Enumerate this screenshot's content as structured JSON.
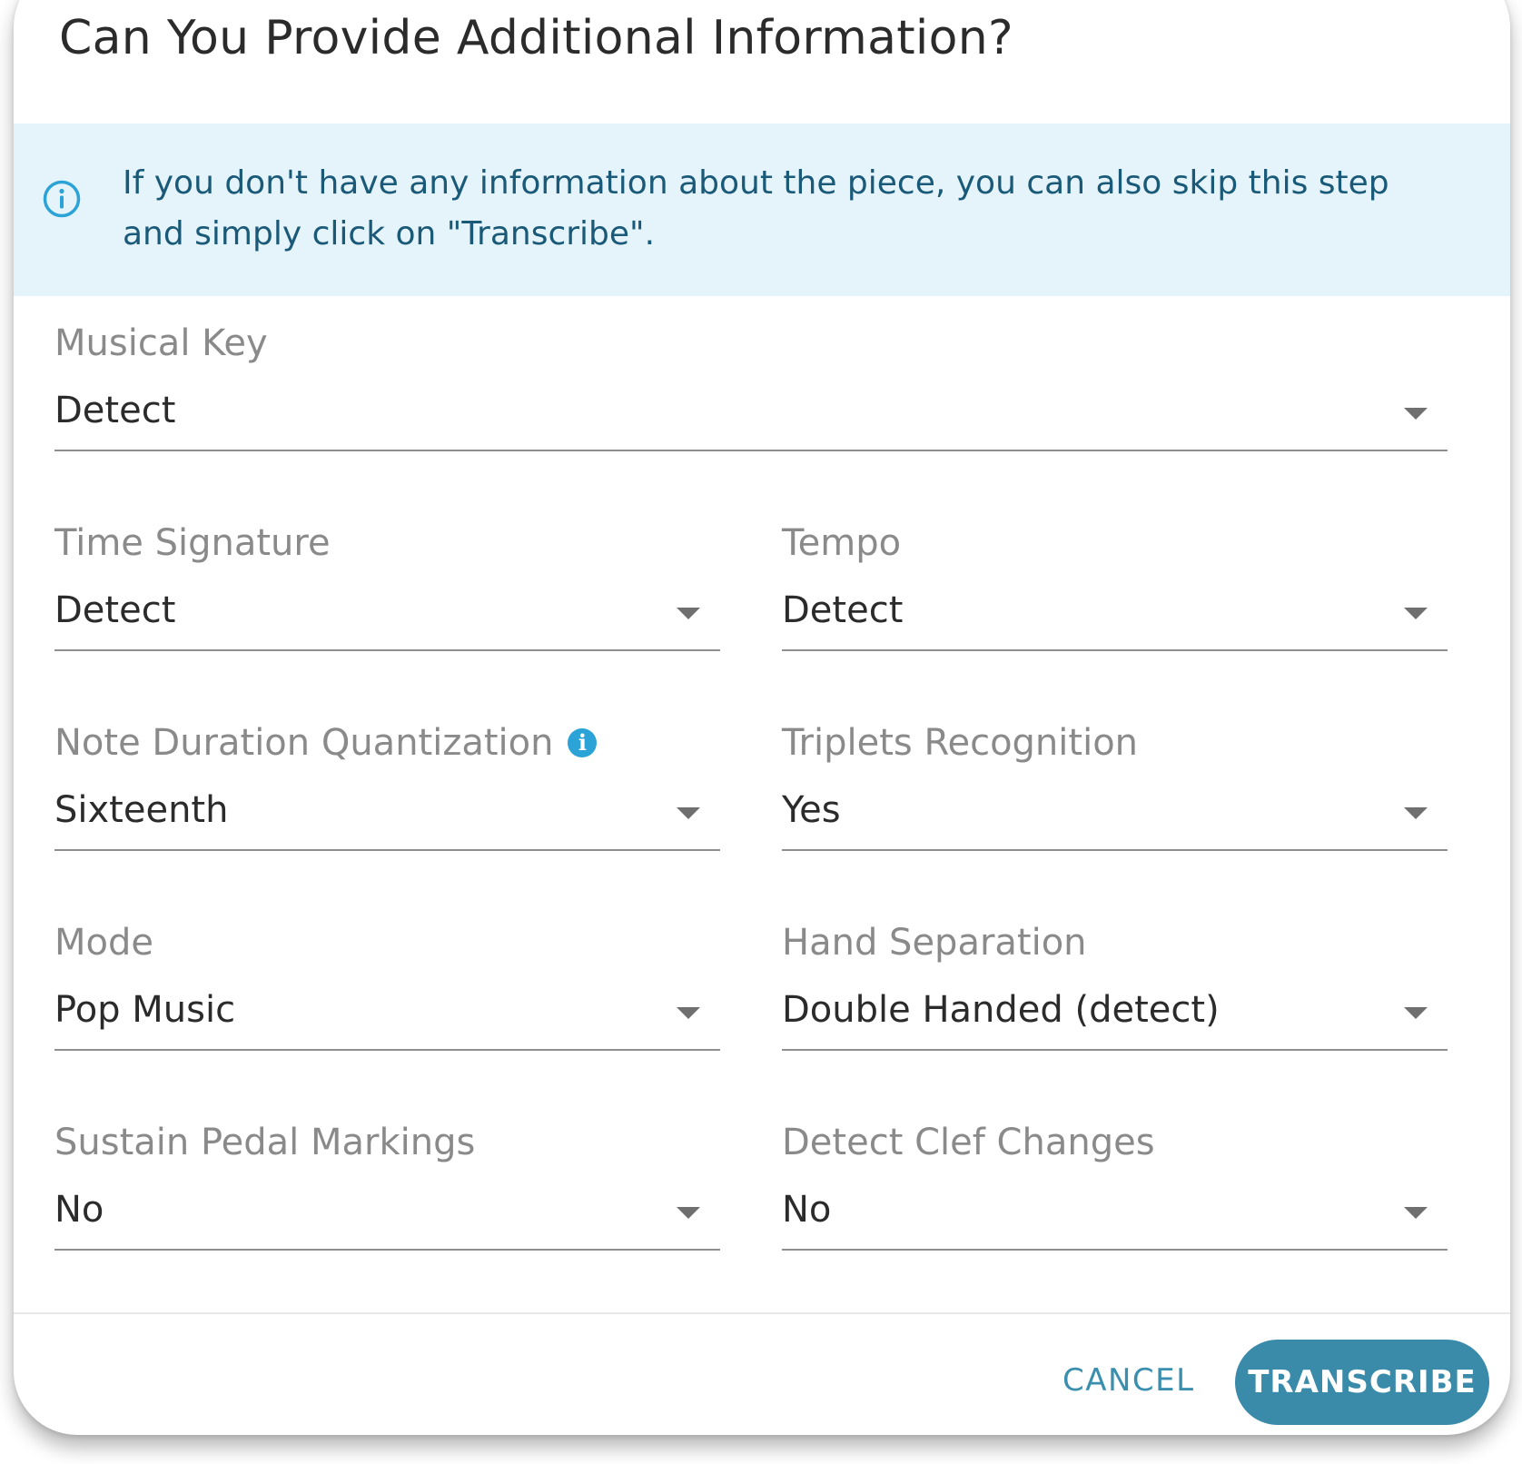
{
  "dialog": {
    "title": "Can You Provide Additional Information?",
    "info_banner": {
      "icon": "info-circle-icon",
      "text": "If you don't have any information about the piece, you can also skip this step and simply click on \"Transcribe\"."
    },
    "fields": {
      "musical_key": {
        "label": "Musical Key",
        "value": "Detect"
      },
      "time_signature": {
        "label": "Time Signature",
        "value": "Detect"
      },
      "tempo": {
        "label": "Tempo",
        "value": "Detect"
      },
      "note_duration_quantization": {
        "label": "Note Duration Quantization",
        "value": "Sixteenth",
        "help_icon": "info-icon"
      },
      "triplets_recognition": {
        "label": "Triplets Recognition",
        "value": "Yes"
      },
      "mode": {
        "label": "Mode",
        "value": "Pop Music"
      },
      "hand_separation": {
        "label": "Hand Separation",
        "value": "Double Handed (detect)"
      },
      "sustain_pedal_markings": {
        "label": "Sustain Pedal Markings",
        "value": "No"
      },
      "detect_clef_changes": {
        "label": "Detect Clef Changes",
        "value": "No"
      }
    },
    "actions": {
      "cancel_label": "CANCEL",
      "transcribe_label": "TRANSCRIBE"
    },
    "colors": {
      "accent": "#3a8aa9",
      "banner_bg": "#e4f4fa",
      "banner_text": "#1a5a78",
      "info_icon": "#2ba3d6"
    }
  }
}
